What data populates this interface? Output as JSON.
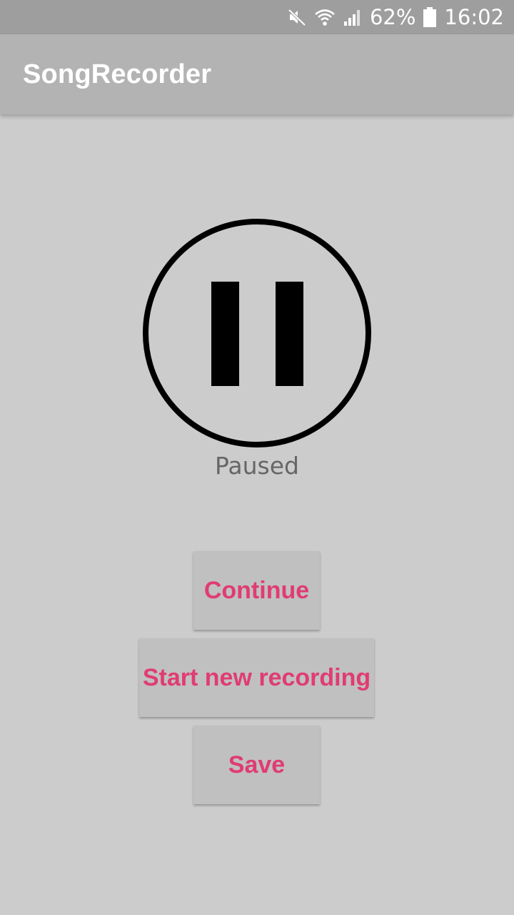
{
  "status_bar": {
    "battery_text": "62%",
    "time": "16:02",
    "icons": [
      "mute-icon",
      "wifi-icon",
      "signal-icon",
      "battery-icon"
    ]
  },
  "app_bar": {
    "title": "SongRecorder"
  },
  "recorder": {
    "state_icon": "pause-icon",
    "state_label": "Paused"
  },
  "actions": {
    "continue_label": "Continue",
    "new_recording_label": "Start new recording",
    "save_label": "Save"
  },
  "colors": {
    "background": "#cccccc",
    "status_bar": "#9e9e9e",
    "app_bar": "#b3b3b3",
    "button_bg": "#c0c0c0",
    "accent": "#e03c72"
  }
}
